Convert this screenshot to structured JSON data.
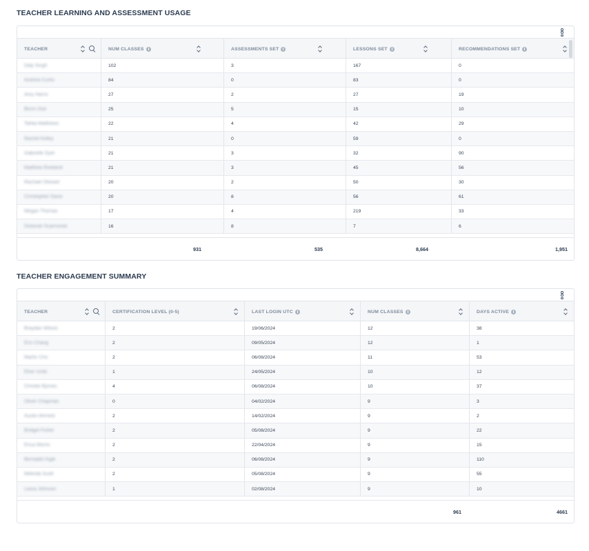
{
  "usage": {
    "title": "TEACHER LEARNING AND ASSESSMENT USAGE",
    "columns": [
      {
        "label": "TEACHER"
      },
      {
        "label": "NUM CLASSES"
      },
      {
        "label": "ASSESSMENTS SET"
      },
      {
        "label": "LESSONS SET"
      },
      {
        "label": "RECOMMENDATIONS SET"
      }
    ],
    "rows": [
      [
        "Dalji Singh",
        "102",
        "3",
        "167",
        "0"
      ],
      [
        "Andrew Curtis",
        "84",
        "0",
        "83",
        "0"
      ],
      [
        "Amy Harris",
        "27",
        "2",
        "27",
        "19"
      ],
      [
        "Bevin Doe",
        "25",
        "5",
        "15",
        "10"
      ],
      [
        "Tahlia Matthews",
        "22",
        "4",
        "42",
        "29"
      ],
      [
        "Rachel Kelley",
        "21",
        "0",
        "59",
        "0"
      ],
      [
        "Gabrielle Dyer",
        "21",
        "3",
        "32",
        "90"
      ],
      [
        "Matthew Rowland",
        "21",
        "3",
        "45",
        "56"
      ],
      [
        "Rachael Stewart",
        "20",
        "2",
        "50",
        "30"
      ],
      [
        "Christopher Davis",
        "20",
        "8",
        "56",
        "61"
      ],
      [
        "Megan Thomas",
        "17",
        "4",
        "219",
        "33"
      ],
      [
        "Deborah Scarmonte",
        "16",
        "8",
        "7",
        "6"
      ]
    ],
    "totals": [
      "931",
      "535",
      "8,664",
      "1,951"
    ]
  },
  "engagement": {
    "title": "TEACHER ENGAGEMENT SUMMARY",
    "columns": [
      {
        "label": "TEACHER"
      },
      {
        "label": "CERTIFICATION LEVEL (0-5)"
      },
      {
        "label": "LAST LOGIN UTC"
      },
      {
        "label": "NUM CLASSES"
      },
      {
        "label": "DAYS ACTIVE"
      }
    ],
    "rows": [
      [
        "Braydan Wilson",
        "2",
        "19/06/2024",
        "12",
        "38"
      ],
      [
        "Erin Chang",
        "2",
        "09/05/2024",
        "12",
        "1"
      ],
      [
        "Martin Cho",
        "2",
        "06/08/2024",
        "11",
        "53"
      ],
      [
        "Elise Unite",
        "1",
        "24/05/2024",
        "10",
        "12"
      ],
      [
        "Christie Byrnes",
        "4",
        "06/08/2024",
        "10",
        "37"
      ],
      [
        "Oliver Chapman",
        "0",
        "04/02/2024",
        "9",
        "3"
      ],
      [
        "Austin Ahrnetz",
        "2",
        "14/02/2024",
        "9",
        "2"
      ],
      [
        "Bridget Fisher",
        "2",
        "05/08/2024",
        "9",
        "22"
      ],
      [
        "Erica Morris",
        "2",
        "22/04/2024",
        "9",
        "15"
      ],
      [
        "Bernadet Ingle",
        "2",
        "06/08/2024",
        "9",
        "110"
      ],
      [
        "Melinda Scott",
        "2",
        "05/08/2024",
        "9",
        "55"
      ],
      [
        "Laura Johnson",
        "1",
        "02/08/2024",
        "9",
        "10"
      ]
    ],
    "totals": [
      "961",
      "4661"
    ]
  }
}
